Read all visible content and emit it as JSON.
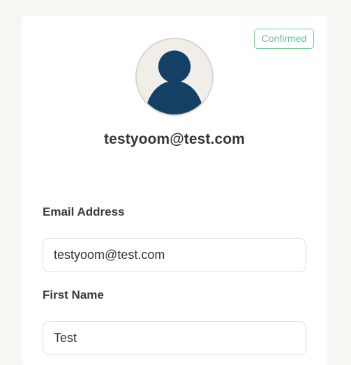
{
  "profile": {
    "status_badge": "Confirmed",
    "email_heading": "testyoom@test.com",
    "avatar_icon": "user-silhouette-icon"
  },
  "form": {
    "email": {
      "label": "Email Address",
      "value": "testyoom@test.com"
    },
    "first_name": {
      "label": "First Name",
      "value": "Test"
    }
  },
  "colors": {
    "page_background": "#f7f6f3",
    "card_background": "#ffffff",
    "badge_green": "#67c68a",
    "avatar_navy": "#144066",
    "avatar_background": "#f1eee9"
  }
}
